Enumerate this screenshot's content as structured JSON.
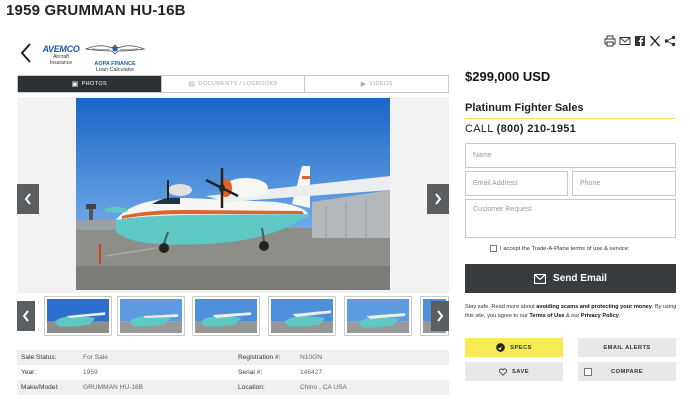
{
  "title": "1959 GRUMMAN HU-16B",
  "logos": {
    "avemco_brand": "AVEMCO",
    "avemco_sub1": "Aircraft",
    "avemco_sub2": "Insurance",
    "aopa_brand": "AOPA FINANCE",
    "aopa_sub": "Loan Calculator"
  },
  "share_icons": [
    "print-icon",
    "email-icon",
    "facebook-icon",
    "x-icon",
    "share-icon"
  ],
  "tabs": [
    {
      "label": "PHOTOS",
      "icon": "photo-icon",
      "active": true
    },
    {
      "label": "DOCUMENTS / LOGBOOKS",
      "icon": "document-icon",
      "active": false
    },
    {
      "label": "VIDEOS",
      "icon": "video-icon",
      "active": false
    }
  ],
  "specs": [
    {
      "label1": "Sale Status:",
      "value1": "For Sale",
      "label2": "Registration #:",
      "value2": "N10GN"
    },
    {
      "label1": "Year:",
      "value1": "1959",
      "label2": "Serial #:",
      "value2": "146427"
    },
    {
      "label1": "Make/Model:",
      "value1": "GRUMMAN HU-16B",
      "label2": "Location:",
      "value2": "Chino , CA USA"
    }
  ],
  "price": "$299,000 USD",
  "seller": "Platinum Fighter Sales",
  "call": {
    "label": "CALL",
    "number": "(800) 210-1951"
  },
  "form": {
    "name_placeholder": "Name",
    "email_placeholder": "Email Address",
    "phone_placeholder": "Phone",
    "request_placeholder": "Customer Request",
    "terms_label": "I accept the Trade-A-Plane terms of use & service:",
    "send_label": "Send Email"
  },
  "notice": {
    "part1": "Stay safe. Read more about ",
    "bold1": "avoiding scams and protecting your money",
    "part2": ". By using this site, you agree to our ",
    "bold2": "Terms of Use",
    "part3": " & our ",
    "bold3": "Privacy Policy",
    "part4": "."
  },
  "actions": {
    "specs": "SPECS",
    "email_alerts": "EMAIL ALERTS",
    "save": "SAVE",
    "compare": "COMPARE"
  },
  "colors": {
    "accent_yellow": "#f8ea55",
    "dark": "#383c3f",
    "aircraft_teal": "#5ec8c4",
    "aircraft_orange": "#e0622d"
  }
}
